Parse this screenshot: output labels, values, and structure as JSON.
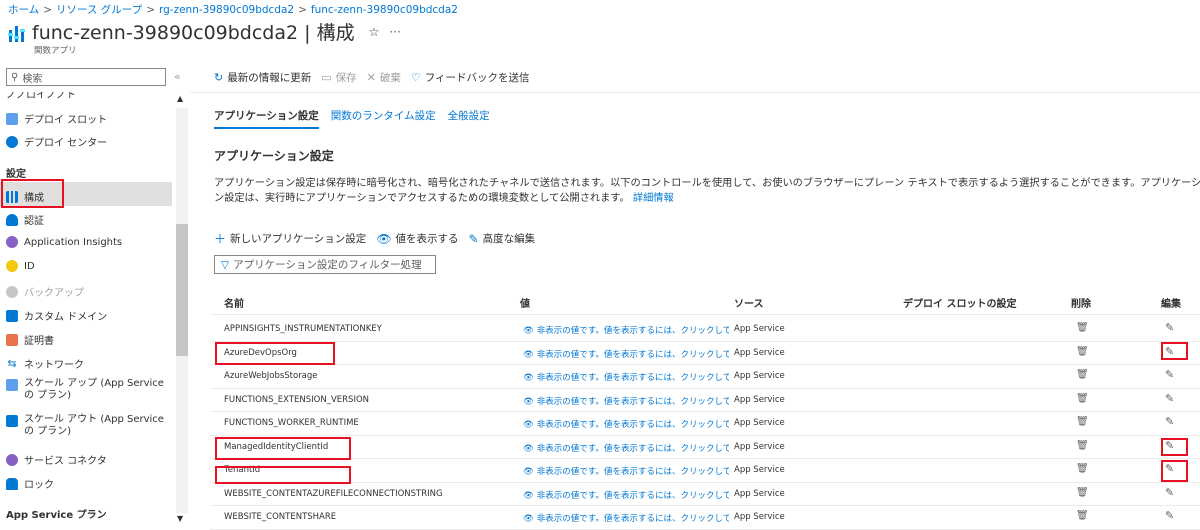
{
  "breadcrumb": [
    "ホーム",
    "リソース グループ",
    "rg-zenn-39890c09bdcda2",
    "func-zenn-39890c09bdcda2"
  ],
  "header": {
    "title": "func-zenn-39890c09bdcda2 | 構成",
    "subtitle": "関数アプリ",
    "favorite_icon": "☆",
    "more_icon": "···"
  },
  "sidebar": {
    "search_placeholder": "検索",
    "collapse_icon": "«",
    "cut_label": "ノノロイノノト",
    "items": [
      {
        "label": "デプロイ スロット",
        "icon_color": "#5ea0ef"
      },
      {
        "label": "デプロイ センター",
        "icon_color": "#0078d4"
      },
      {
        "label": "設定",
        "section": true
      },
      {
        "label": "構成",
        "icon_color": "#0078d4",
        "selected": true
      },
      {
        "label": "認証",
        "icon_color": "#0078d4"
      },
      {
        "label": "Application Insights",
        "icon_color": "#8661c5"
      },
      {
        "label": "ID",
        "icon_color": "#f2c811"
      },
      {
        "label": "バックアップ",
        "icon_color": "#a19f9d",
        "disabled": true
      },
      {
        "label": "カスタム ドメイン",
        "icon_color": "#0078d4"
      },
      {
        "label": "証明書",
        "icon_color": "#e8734a"
      },
      {
        "label": "ネットワーク",
        "icon_color": "#0078d4"
      },
      {
        "label": "スケール アップ (App Service の プラン)",
        "icon_color": "#0078d4"
      },
      {
        "label": "スケール アウト (App Service の プラン)",
        "icon_color": "#0078d4"
      },
      {
        "label": "サービス コネクタ",
        "icon_color": "#8661c5"
      },
      {
        "label": "ロック",
        "icon_color": "#0078d4"
      },
      {
        "label": "App Service プラン",
        "section": true
      }
    ]
  },
  "toolbar": {
    "refresh": "最新の情報に更新",
    "save": "保存",
    "discard": "破棄",
    "feedback": "フィードバックを送信"
  },
  "tabs": [
    "アプリケーション設定",
    "関数のランタイム設定",
    "全般設定"
  ],
  "section": {
    "title": "アプリケーション設定",
    "description": "アプリケーション設定は保存時に暗号化され、暗号化されたチャネルで送信されます。以下のコントロールを使用して、お使いのブラウザーにプレーン テキストで表示するよう選択することができます。アプリケーション設定は、実行時にアプリケーションでアクセスするための環境変数として公開されます。",
    "more_info": "詳細情報"
  },
  "actions": {
    "new_setting": "新しいアプリケーション設定",
    "show_values": "値を表示する",
    "advanced_edit": "高度な編集"
  },
  "filter_placeholder": "アプリケーション設定のフィルター処理",
  "table": {
    "columns": [
      "名前",
      "値",
      "ソース",
      "デプロイ スロットの設定",
      "削除",
      "編集"
    ],
    "hidden_value_text": "非表示の値です。値を表示するには、クリックしてください",
    "rows": [
      {
        "name": "APPINSIGHTS_INSTRUMENTATIONKEY",
        "source": "App Service"
      },
      {
        "name": "AzureDevOpsOrg",
        "source": "App Service"
      },
      {
        "name": "AzureWebJobsStorage",
        "source": "App Service"
      },
      {
        "name": "FUNCTIONS_EXTENSION_VERSION",
        "source": "App Service"
      },
      {
        "name": "FUNCTIONS_WORKER_RUNTIME",
        "source": "App Service"
      },
      {
        "name": "ManagedIdentityClientId",
        "source": "App Service"
      },
      {
        "name": "TenantId",
        "source": "App Service"
      },
      {
        "name": "WEBSITE_CONTENTAZUREFILECONNECTIONSTRING",
        "source": "App Service"
      },
      {
        "name": "WEBSITE_CONTENTSHARE",
        "source": "App Service"
      }
    ]
  },
  "colors": {
    "accent": "#0078d4",
    "highlight": "#e81123"
  }
}
